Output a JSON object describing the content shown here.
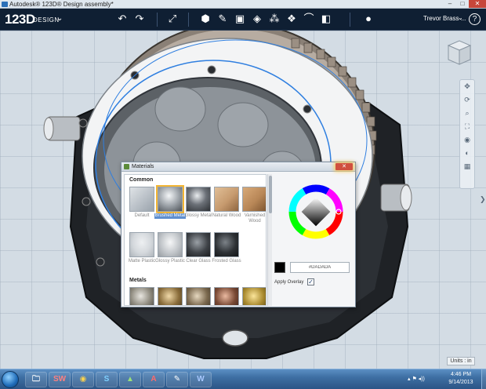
{
  "window": {
    "title": "Autodesk® 123D® Design assembly*",
    "minimize": "–",
    "maximize": "□",
    "close": "✕"
  },
  "app": {
    "logo": "123D",
    "logo_sub": "DESIGN",
    "logo_chevron": "⌄",
    "user": "Trevor Brass ...",
    "user_chevron": "⌄",
    "help": "?",
    "tools": [
      {
        "icon": "undo-icon",
        "glyph": "↶"
      },
      {
        "icon": "redo-icon",
        "glyph": "↷"
      },
      {
        "icon": "transform-icon",
        "glyph": "⤢"
      },
      {
        "icon": "primitives-icon",
        "glyph": "⬢"
      },
      {
        "icon": "sketch-icon",
        "glyph": "✎"
      },
      {
        "icon": "construct-icon",
        "glyph": "▣"
      },
      {
        "icon": "modify-icon",
        "glyph": "◈"
      },
      {
        "icon": "pattern-icon",
        "glyph": "⁂"
      },
      {
        "icon": "group-icon",
        "glyph": "❖"
      },
      {
        "icon": "snap-icon",
        "glyph": "⌒"
      },
      {
        "icon": "measure-icon",
        "glyph": "◧"
      },
      {
        "icon": "material-icon",
        "glyph": "●"
      }
    ]
  },
  "viewport": {
    "units_label": "Units : in",
    "nav_icons": [
      "pan-icon",
      "orbit-icon",
      "zoom-icon",
      "fit-icon",
      "look-icon",
      "visibility-icon",
      "grid-icon"
    ],
    "side_arrow": "❯"
  },
  "materials": {
    "title": "Materials",
    "close": "✕",
    "sections": [
      {
        "label": "Common",
        "items": [
          {
            "label": "Default",
            "color": "#b8bfc7",
            "selected": false
          },
          {
            "label": "Brushed Metal",
            "color": "#9ea4aa",
            "selected": true
          },
          {
            "label": "Glossy Metal",
            "color": "#6c7178",
            "selected": false
          },
          {
            "label": "Natural Wood",
            "color": "#c69a6e",
            "selected": false
          },
          {
            "label": "Varnished Wood",
            "color": "#b88757",
            "selected": false
          },
          {
            "label": "Matte Plastic",
            "color": "#d4d8dc",
            "selected": false
          },
          {
            "label": "Glossy Plastic",
            "color": "#c3c7cb",
            "selected": false
          },
          {
            "label": "Clear Glass",
            "color": "#3f4348",
            "selected": false
          },
          {
            "label": "Frosted Glass",
            "color": "#2d3135",
            "selected": false
          }
        ]
      },
      {
        "label": "Metals",
        "items": [
          {
            "color": "#8e8a7e"
          },
          {
            "color": "#8a6d3b"
          },
          {
            "color": "#7c6a4f"
          },
          {
            "color": "#7a4a35"
          },
          {
            "color": "#a8892e"
          }
        ]
      }
    ],
    "color_hex": "#DADADA",
    "swatch_color": "#000000",
    "apply_overlay_label": "Apply Overlay",
    "apply_overlay_checked": "✓"
  },
  "taskbar": {
    "apps": [
      {
        "name": "explorer",
        "glyph": "🗀"
      },
      {
        "name": "solidworks",
        "glyph": "SW"
      },
      {
        "name": "chrome",
        "glyph": "◉"
      },
      {
        "name": "skype",
        "glyph": "S"
      },
      {
        "name": "123d-catch",
        "glyph": "▲"
      },
      {
        "name": "autocad",
        "glyph": "A"
      },
      {
        "name": "notes",
        "glyph": "✎"
      },
      {
        "name": "word",
        "glyph": "W"
      }
    ],
    "tray": "▴ ⚑ ◂))",
    "time": "4:46 PM",
    "date": "9/14/2013"
  }
}
